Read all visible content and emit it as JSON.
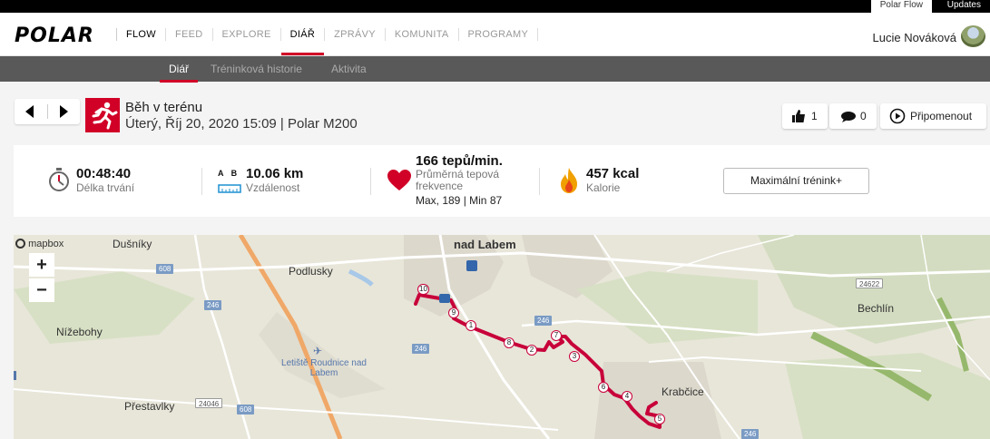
{
  "topbar": {
    "links": [
      "Polar Flow",
      "Updates"
    ]
  },
  "nav": {
    "logo": "POLAR",
    "items": [
      "FLOW",
      "FEED",
      "EXPLORE",
      "DIÁŘ",
      "ZPRÁVY",
      "KOMUNITA",
      "PROGRAMY"
    ],
    "active": "DIÁŘ",
    "user_name": "Lucie Nováková"
  },
  "subnav": {
    "items": [
      "Diář",
      "Tréninková historie",
      "Aktivita"
    ],
    "active": "Diář"
  },
  "session": {
    "sport": "Běh v terénu",
    "details": "Úterý, Říj 20, 2020 15:09 | Polar M200",
    "likes": "1",
    "comments": "0",
    "remind_label": "Připomenout"
  },
  "stats": {
    "duration": {
      "value": "00:48:40",
      "label": "Délka trvání"
    },
    "distance": {
      "prefix": "A B",
      "value": "10.06 km",
      "label": "Vzdálenost"
    },
    "heart_rate": {
      "value": "166 tepů/min.",
      "label": "Průměrná tepová frekvence",
      "minmax": "Max, 189 | Min 87"
    },
    "calories": {
      "value": "457 kcal",
      "label": "Kalorie"
    },
    "training_button": "Maximální trénink+"
  },
  "map": {
    "attribution": "mapbox",
    "zoom_in": "+",
    "zoom_out": "−",
    "places": [
      "Dušníky",
      "nad Labem",
      "Podlusky",
      "Nížebohy",
      "Letiště Roudnice nad Labem",
      "Přestavlky",
      "Bechlín",
      "Krabčice"
    ],
    "road_labels": [
      "608",
      "246",
      "246",
      "246",
      "24046",
      "608",
      "24622",
      "246"
    ],
    "km_markers": [
      "10",
      "9",
      "1",
      "8",
      "2",
      "7",
      "3",
      "6",
      "4",
      "5"
    ],
    "route_color": "#c8003a"
  }
}
